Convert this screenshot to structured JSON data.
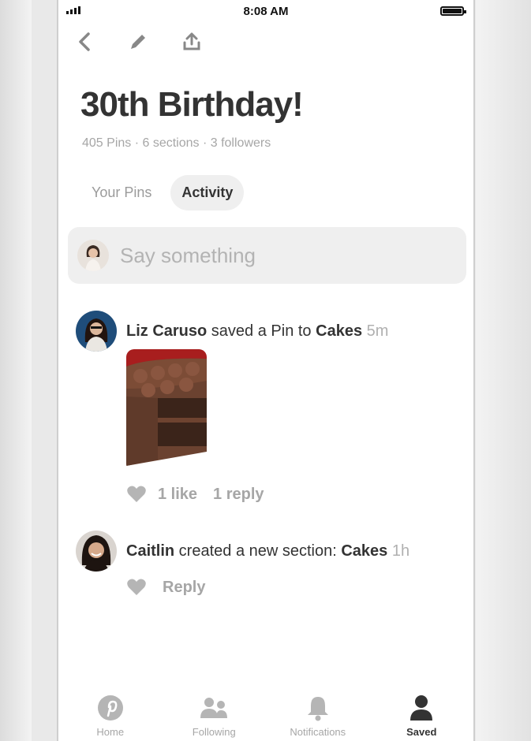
{
  "status": {
    "time": "8:08 AM"
  },
  "toolbar": {
    "back_icon": "chevron-left-icon",
    "edit_icon": "pencil-icon",
    "share_icon": "share-upload-icon"
  },
  "board": {
    "title": "30th Birthday!",
    "meta": "405 Pins · 6 sections · 3 followers"
  },
  "tabs": [
    {
      "label": "Your Pins",
      "active": false
    },
    {
      "label": "Activity",
      "active": true
    }
  ],
  "composer": {
    "placeholder": "Say something"
  },
  "feed": [
    {
      "user": "Liz Caruso",
      "action": " saved a Pin to ",
      "target": "Cakes",
      "ago": " 5m",
      "likes": "1 like",
      "replies": "1 reply"
    },
    {
      "user": "Caitlin",
      "action": " created a new section: ",
      "target": "Cakes",
      "ago": " 1h",
      "reply": "Reply"
    }
  ],
  "nav": [
    {
      "label": "Home",
      "icon": "pinterest-logo-icon",
      "active": false
    },
    {
      "label": "Following",
      "icon": "people-icon",
      "active": false
    },
    {
      "label": "Notifications",
      "icon": "bell-icon",
      "active": false
    },
    {
      "label": "Saved",
      "icon": "person-icon",
      "active": true
    }
  ],
  "colors": {
    "accent_text": "#333333",
    "muted": "#a6a6a6",
    "chip_bg": "#efefef"
  }
}
